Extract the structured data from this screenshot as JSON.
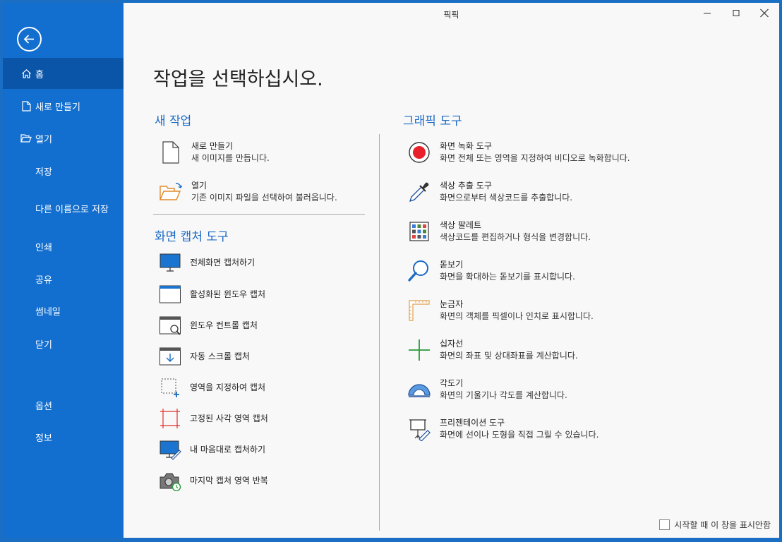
{
  "window": {
    "title": "픽픽"
  },
  "sidebar": {
    "items": [
      {
        "label": "홈",
        "icon": "home-icon",
        "active": true
      },
      {
        "label": "새로 만들기",
        "icon": "file-icon"
      },
      {
        "label": "열기",
        "icon": "folder-open-icon"
      },
      {
        "label": "저장"
      },
      {
        "label": "다른 이름으로 저장"
      },
      {
        "label": "인쇄"
      },
      {
        "label": "공유"
      },
      {
        "label": "썸네일"
      },
      {
        "label": "닫기"
      },
      {
        "label": "옵션"
      },
      {
        "label": "정보"
      }
    ]
  },
  "main": {
    "page_title": "작업을 선택하십시오.",
    "new_task": {
      "heading": "새 작업",
      "items": [
        {
          "title": "새로 만들기",
          "desc": "새 이미지를 만듭니다."
        },
        {
          "title": "열기",
          "desc": "기존 이미지 파일을 선택하여 불러옵니다."
        }
      ]
    },
    "capture_tools": {
      "heading": "화면 캡처 도구",
      "items": [
        {
          "label": "전체화면 캡처하기"
        },
        {
          "label": "활성화된 윈도우 캡처"
        },
        {
          "label": "윈도우 컨트롤 캡처"
        },
        {
          "label": "자동 스크롤 캡처"
        },
        {
          "label": "영역을 지정하여 캡처"
        },
        {
          "label": "고정된 사각 영역 캡처"
        },
        {
          "label": "내 마음대로 캡처하기"
        },
        {
          "label": "마지막 캡처 영역 반복"
        }
      ]
    },
    "graphic_tools": {
      "heading": "그래픽 도구",
      "items": [
        {
          "title": "화면 녹화 도구",
          "desc": "화면 전체 또는 영역을 지정하여 비디오로 녹화합니다."
        },
        {
          "title": "색상 추출 도구",
          "desc": "화면으로부터 색상코드를 추출합니다."
        },
        {
          "title": "색상 팔레트",
          "desc": "색상코드를 편집하거나 형식을 변경합니다."
        },
        {
          "title": "돋보기",
          "desc": "화면을 확대하는 돋보기를 표시합니다."
        },
        {
          "title": "눈금자",
          "desc": "화면의 객체를 픽셀이나 인치로 표시합니다."
        },
        {
          "title": "십자선",
          "desc": "화면의 좌표 및 상대좌표를 계산합니다."
        },
        {
          "title": "각도기",
          "desc": "화면의 기울기나 각도를 계산합니다."
        },
        {
          "title": "프리젠테이션 도구",
          "desc": "화면에 선이나 도형을 직접 그릴 수 있습니다."
        }
      ]
    },
    "startup_checkbox_label": "시작할 때 이 창을 표시안함"
  },
  "colors": {
    "sidebar": "#136fcf",
    "sidebar_active": "#0b55a8",
    "accent": "#1b6ac4",
    "record": "#e8202a"
  }
}
